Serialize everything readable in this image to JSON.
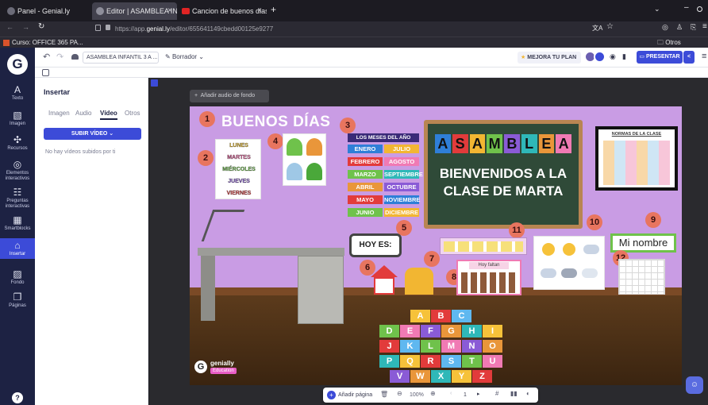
{
  "browser": {
    "tabs": [
      {
        "label": "Panel - Genial.ly",
        "icon": "genially-icon"
      },
      {
        "label": "Editor | ASAMBLEA INFA",
        "icon": "genially-icon"
      },
      {
        "label": "Cancion de buenos dias",
        "icon": "youtube-icon"
      }
    ],
    "url_prefix": "https://app.",
    "url_domain": "genial.ly",
    "url_path": "/editor/655641149cbedd00125e9277",
    "bookmark": "Curso: OFFICE 365 PA...",
    "other_bookmarks": "Otros marcadores"
  },
  "toolbar": {
    "doc_name": "ASAMBLEA INFANTIL 3 A ...",
    "draft": "Borrador",
    "upgrade": "MEJORA TU PLAN",
    "present": "PRESENTAR"
  },
  "leftnav": [
    {
      "label": "Texto",
      "icon": "A"
    },
    {
      "label": "Imagen",
      "icon": "▧"
    },
    {
      "label": "Recursos",
      "icon": "✣"
    },
    {
      "label": "Elementos interactivos",
      "icon": "◎"
    },
    {
      "label": "Preguntas interactivas",
      "icon": "☷"
    },
    {
      "label": "Smartblocks",
      "icon": "▦"
    },
    {
      "label": "Insertar",
      "icon": "⌂"
    },
    {
      "label": "Fondo",
      "icon": "▨"
    },
    {
      "label": "Páginas",
      "icon": "❐"
    }
  ],
  "panel": {
    "title": "Insertar",
    "tabs": [
      "Imagen",
      "Audio",
      "Vídeo",
      "Otros"
    ],
    "active_tab": "Vídeo",
    "upload_button": "SUBIR VÍDEO",
    "empty_text": "No hay vídeos subidos por ti"
  },
  "canvas": {
    "add_audio": "Añadir audio de fondo",
    "add_page": "Añadir página",
    "zoom": "100%",
    "page_number": "1"
  },
  "slide": {
    "greeting": "BUENOS DÍAS",
    "week_days": [
      "LUNES",
      "MARTES",
      "MIÉRCOLES",
      "JUEVES",
      "VIERNES"
    ],
    "months_title": "LOS MESES DEL AÑO",
    "months": [
      "ENERO",
      "JULIO",
      "FEBRERO",
      "AGOSTO",
      "MARZO",
      "SEPTIEMBRE",
      "ABRIL",
      "OCTUBRE",
      "MAYO",
      "NOVIEMBRE",
      "JUNIO",
      "DICIEMBRE"
    ],
    "board_title": "ASAMBLEA",
    "board_text": "BIENVENIDOS A LA CLASE DE MARTA",
    "rules_title": "NORMAS DE LA CLASE",
    "today_label": "HOY ES:",
    "name_label": "Mi nombre",
    "missing_label": "Hoy faltan",
    "brand": "genially",
    "brand_badge": "Education",
    "numbers": [
      "1",
      "2",
      "3",
      "4",
      "5",
      "6",
      "7",
      "8",
      "9",
      "10",
      "11",
      "12"
    ],
    "puzzle_letters": [
      "A",
      "B",
      "C",
      "D",
      "E",
      "F",
      "G",
      "H",
      "I",
      "J",
      "K",
      "L",
      "M",
      "N",
      "O",
      "P",
      "Q",
      "R",
      "S",
      "T",
      "U",
      "V",
      "W",
      "X",
      "Y",
      "Z"
    ]
  },
  "colors": {
    "accent": "#3c4bd8",
    "nav_bg": "#1d2243",
    "slide_bg": "#c99ce4",
    "number_badge": "#e8755f",
    "board_green": "#2f4a38"
  }
}
